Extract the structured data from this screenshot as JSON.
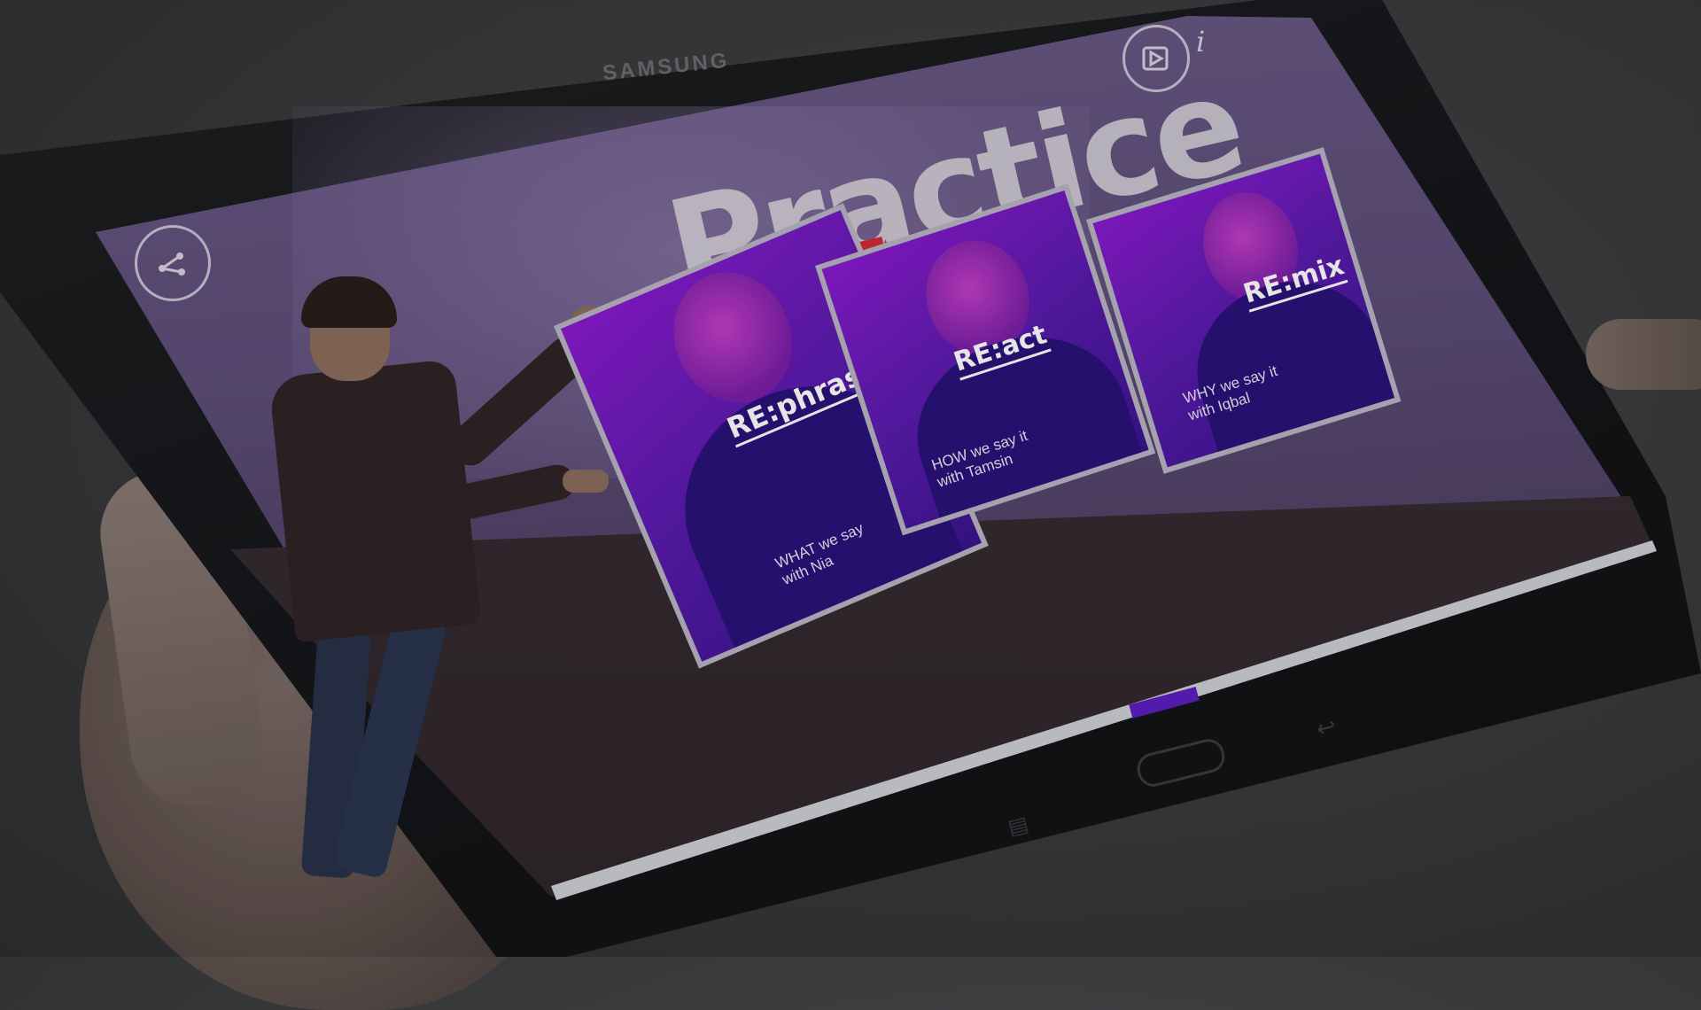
{
  "device": {
    "brand": "SAMSUNG"
  },
  "header": {
    "title": "Practice",
    "info_label": "i"
  },
  "cards": [
    {
      "title": "RE:phrase",
      "subtitle": "WHAT we say\nwith Nia"
    },
    {
      "title": "RE:act",
      "subtitle": "HOW we say it\nwith Tamsin"
    },
    {
      "title": "RE:mix",
      "subtitle": "WHY we say it\nwith Iqbal"
    }
  ],
  "pager": {
    "current_page": 2,
    "total_pages": 3
  },
  "icons": {
    "share": "share-icon",
    "play": "play-icon",
    "info": "info-icon",
    "home": "home-button-icon",
    "menu": "menu-icon",
    "back": "back-icon"
  },
  "colors": {
    "accent_purple": "#5c1fc0",
    "title_underline": "#d42a3a",
    "card_border": "#b9b4c2"
  }
}
